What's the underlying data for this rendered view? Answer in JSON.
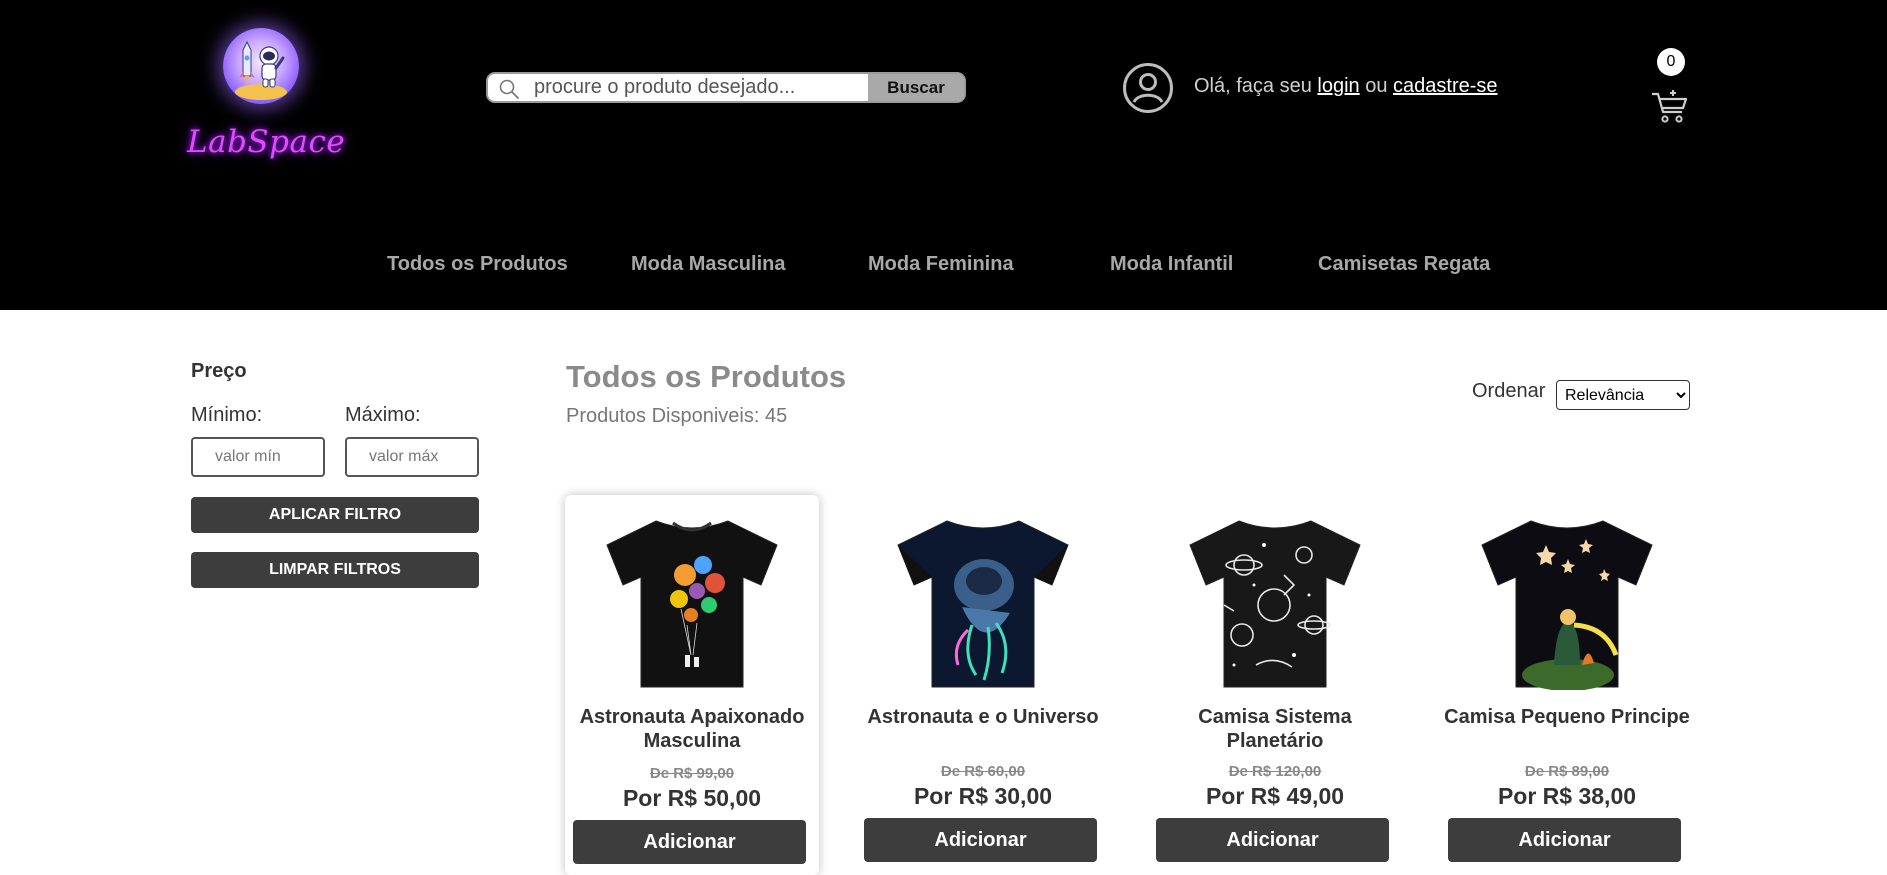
{
  "header": {
    "logo_text": "LabSpace",
    "search": {
      "placeholder": "procure o produto desejado...",
      "button_label": "Buscar"
    },
    "greeting": {
      "prefix": "Olá, faça seu",
      "login": "login",
      "or": "ou",
      "signup": "cadastre-se"
    },
    "cart_count": "0",
    "nav": [
      "Todos os Produtos",
      "Moda Masculina",
      "Moda Feminina",
      "Moda Infantil",
      "Camisetas Regata"
    ]
  },
  "filter": {
    "title": "Preço",
    "min_label": "Mínimo:",
    "max_label": "Máximo:",
    "min_placeholder": "valor mín",
    "max_placeholder": "valor máx",
    "apply_label": "APLICAR FILTRO",
    "clear_label": "LIMPAR FILTROS"
  },
  "main": {
    "title": "Todos os Produtos",
    "count_text": "Produtos Disponiveis: 45",
    "sort_label": "Ordenar",
    "sort_selected": "Relevância"
  },
  "products": [
    {
      "name": "Astronauta Apaixonado Masculina",
      "old_price": "De R$ 99,00",
      "new_price": "Por R$ 50,00",
      "button": "Adicionar"
    },
    {
      "name": "Astronauta e o Universo",
      "old_price": "De R$ 60,00",
      "new_price": "Por R$ 30,00",
      "button": "Adicionar"
    },
    {
      "name": "Camisa Sistema Planetário",
      "old_price": "De R$ 120,00",
      "new_price": "Por R$ 49,00",
      "button": "Adicionar"
    },
    {
      "name": "Camisa Pequeno Principe",
      "old_price": "De R$ 89,00",
      "new_price": "Por R$ 38,00",
      "button": "Adicionar"
    }
  ],
  "colors": {
    "header_bg": "#000000",
    "button_dark": "#3d3d3d",
    "logo_pink": "#e14bff"
  }
}
